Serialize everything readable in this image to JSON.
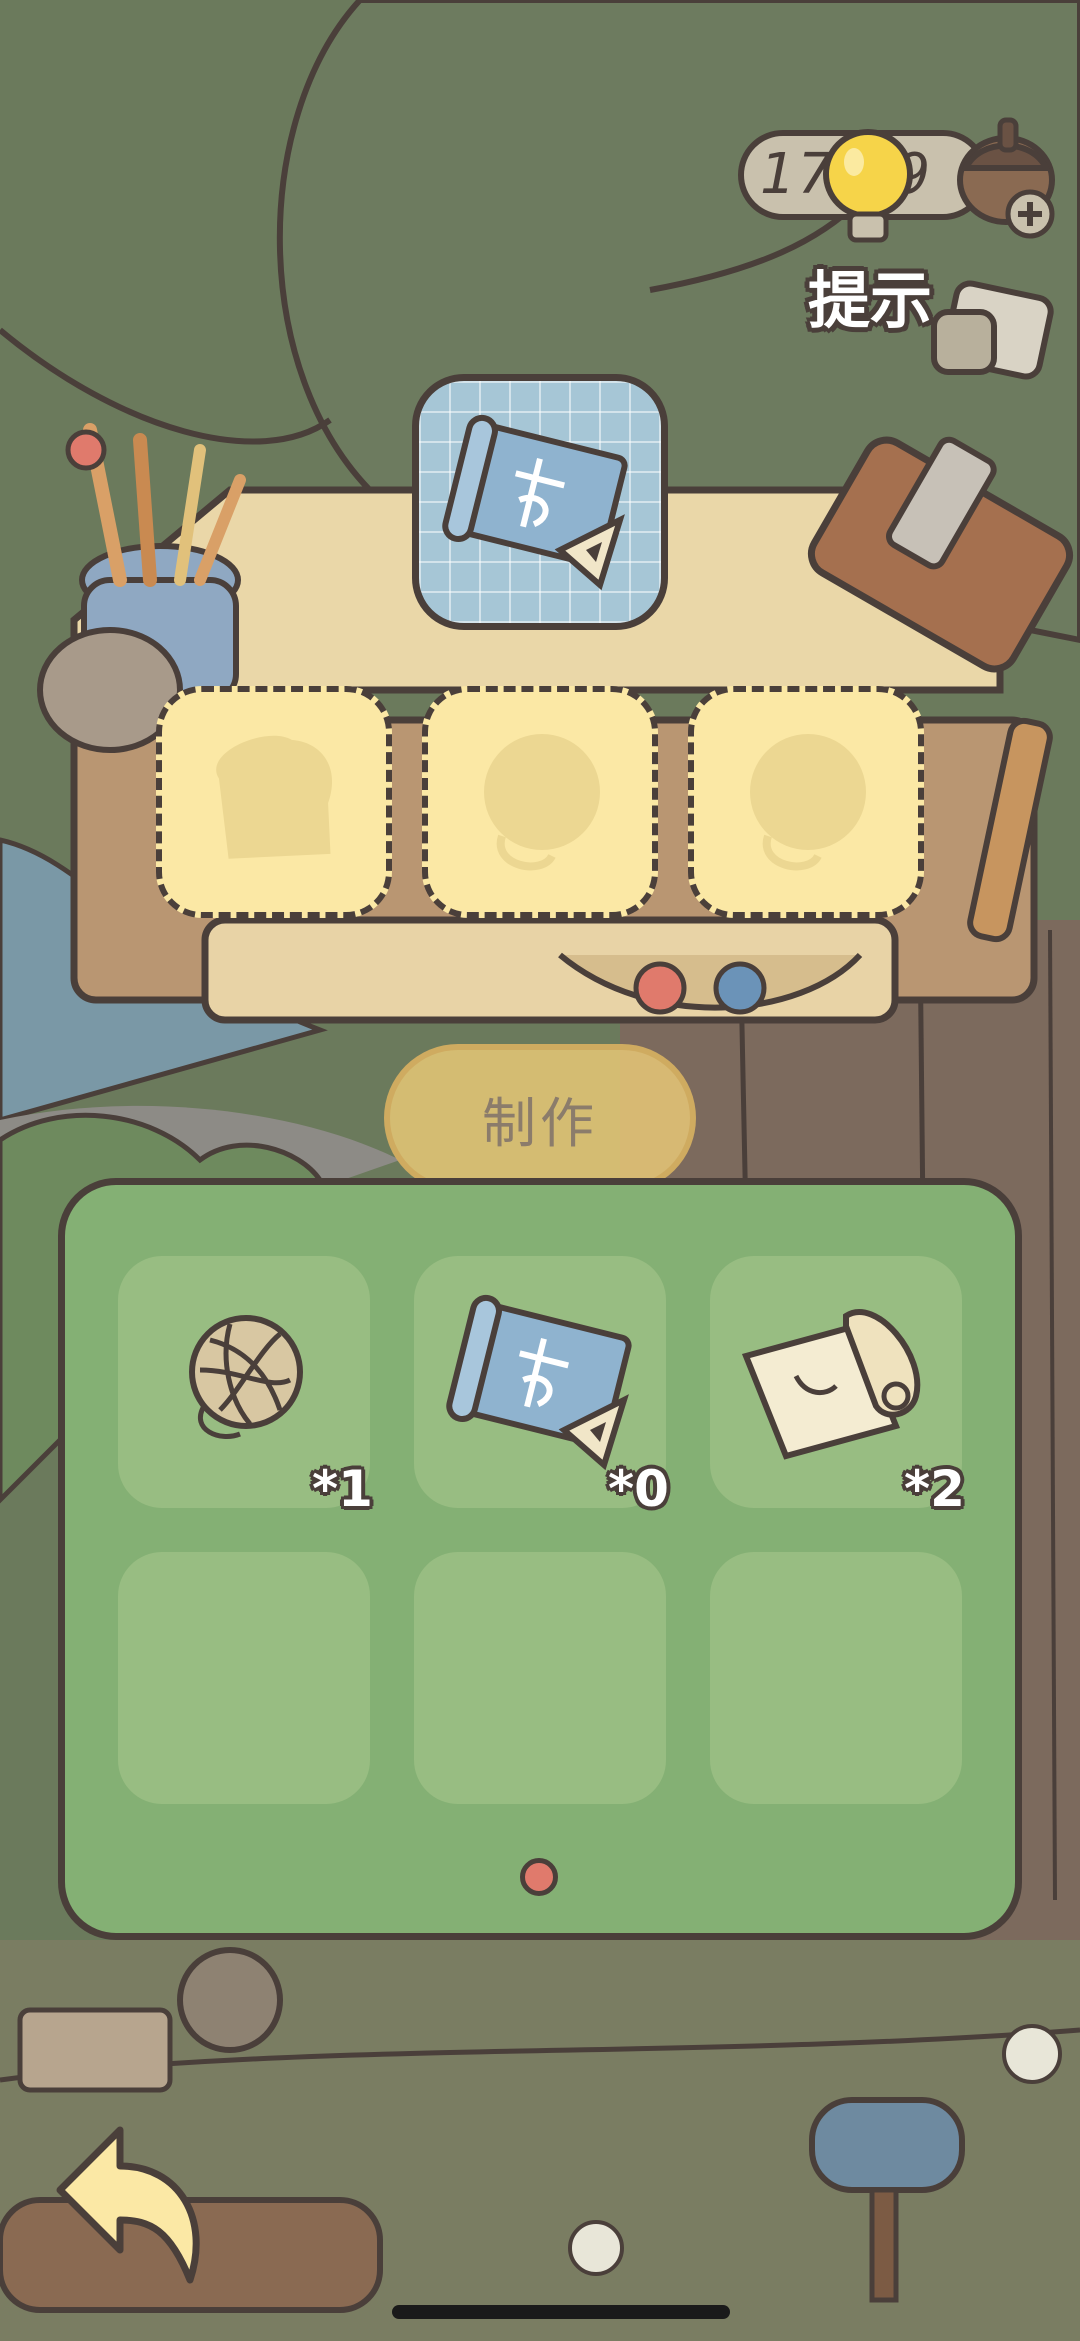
{
  "hud": {
    "coin_count": "17   9",
    "hint_label": "提示"
  },
  "workbench": {
    "target_item": "blueprint",
    "recipe_slots": [
      "bread-ghost",
      "yarn-ghost",
      "yarn-ghost"
    ]
  },
  "make_button": {
    "label": "制作",
    "enabled": false
  },
  "inventory": {
    "items": [
      {
        "name": "yarn-ball",
        "qty": "*1"
      },
      {
        "name": "blueprint",
        "qty": "*0"
      },
      {
        "name": "paper-scroll",
        "qty": "*2"
      },
      {
        "name": "empty",
        "qty": ""
      },
      {
        "name": "empty",
        "qty": ""
      },
      {
        "name": "empty",
        "qty": ""
      }
    ],
    "page": 1,
    "page_count": 1
  },
  "colors": {
    "outline": "#4a3f3a",
    "panel_green": "#84b074",
    "slot_green": "#98bd82",
    "page_dot": "#e07a6c",
    "make_button": "#ecca78"
  }
}
